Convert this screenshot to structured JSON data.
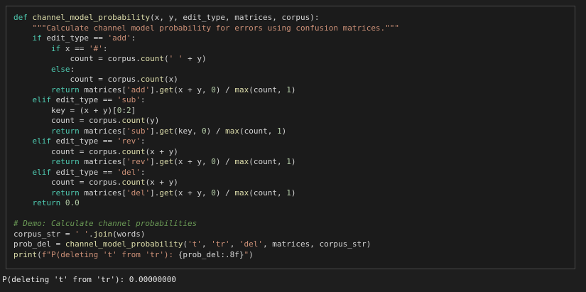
{
  "code_cell": {
    "lines": [
      [
        {
          "t": "def ",
          "c": "keyword"
        },
        {
          "t": "channel_model_probability",
          "c": "fn"
        },
        {
          "t": "(x, y, edit_type, matrices, corpus):",
          "c": "default"
        }
      ],
      [
        {
          "t": "    \"\"\"Calculate channel model probability for errors using confusion matrices.\"\"\"",
          "c": "docstring"
        }
      ],
      [
        {
          "t": "    ",
          "c": "default"
        },
        {
          "t": "if",
          "c": "keyword"
        },
        {
          "t": " edit_type ",
          "c": "default"
        },
        {
          "t": "==",
          "c": "op"
        },
        {
          "t": " ",
          "c": "default"
        },
        {
          "t": "'add'",
          "c": "string"
        },
        {
          "t": ":",
          "c": "default"
        }
      ],
      [
        {
          "t": "        ",
          "c": "default"
        },
        {
          "t": "if",
          "c": "keyword"
        },
        {
          "t": " x ",
          "c": "default"
        },
        {
          "t": "==",
          "c": "op"
        },
        {
          "t": " ",
          "c": "default"
        },
        {
          "t": "'#'",
          "c": "string"
        },
        {
          "t": ":",
          "c": "default"
        }
      ],
      [
        {
          "t": "            count ",
          "c": "default"
        },
        {
          "t": "=",
          "c": "op"
        },
        {
          "t": " corpus.",
          "c": "default"
        },
        {
          "t": "count",
          "c": "fn"
        },
        {
          "t": "(",
          "c": "default"
        },
        {
          "t": "' '",
          "c": "string"
        },
        {
          "t": " + y)",
          "c": "default"
        }
      ],
      [
        {
          "t": "        ",
          "c": "default"
        },
        {
          "t": "else",
          "c": "keyword"
        },
        {
          "t": ":",
          "c": "default"
        }
      ],
      [
        {
          "t": "            count ",
          "c": "default"
        },
        {
          "t": "=",
          "c": "op"
        },
        {
          "t": " corpus.",
          "c": "default"
        },
        {
          "t": "count",
          "c": "fn"
        },
        {
          "t": "(x)",
          "c": "default"
        }
      ],
      [
        {
          "t": "        ",
          "c": "default"
        },
        {
          "t": "return",
          "c": "keyword"
        },
        {
          "t": " matrices[",
          "c": "default"
        },
        {
          "t": "'add'",
          "c": "string"
        },
        {
          "t": "].",
          "c": "default"
        },
        {
          "t": "get",
          "c": "fn"
        },
        {
          "t": "(x + y, ",
          "c": "default"
        },
        {
          "t": "0",
          "c": "number"
        },
        {
          "t": ") / ",
          "c": "default"
        },
        {
          "t": "max",
          "c": "fn"
        },
        {
          "t": "(count, ",
          "c": "default"
        },
        {
          "t": "1",
          "c": "number"
        },
        {
          "t": ")",
          "c": "default"
        }
      ],
      [
        {
          "t": "    ",
          "c": "default"
        },
        {
          "t": "elif",
          "c": "keyword"
        },
        {
          "t": " edit_type ",
          "c": "default"
        },
        {
          "t": "==",
          "c": "op"
        },
        {
          "t": " ",
          "c": "default"
        },
        {
          "t": "'sub'",
          "c": "string"
        },
        {
          "t": ":",
          "c": "default"
        }
      ],
      [
        {
          "t": "        key ",
          "c": "default"
        },
        {
          "t": "=",
          "c": "op"
        },
        {
          "t": " (x + y)[",
          "c": "default"
        },
        {
          "t": "0",
          "c": "number"
        },
        {
          "t": ":",
          "c": "default"
        },
        {
          "t": "2",
          "c": "number"
        },
        {
          "t": "]",
          "c": "default"
        }
      ],
      [
        {
          "t": "        count ",
          "c": "default"
        },
        {
          "t": "=",
          "c": "op"
        },
        {
          "t": " corpus.",
          "c": "default"
        },
        {
          "t": "count",
          "c": "fn"
        },
        {
          "t": "(y)",
          "c": "default"
        }
      ],
      [
        {
          "t": "        ",
          "c": "default"
        },
        {
          "t": "return",
          "c": "keyword"
        },
        {
          "t": " matrices[",
          "c": "default"
        },
        {
          "t": "'sub'",
          "c": "string"
        },
        {
          "t": "].",
          "c": "default"
        },
        {
          "t": "get",
          "c": "fn"
        },
        {
          "t": "(key, ",
          "c": "default"
        },
        {
          "t": "0",
          "c": "number"
        },
        {
          "t": ") / ",
          "c": "default"
        },
        {
          "t": "max",
          "c": "fn"
        },
        {
          "t": "(count, ",
          "c": "default"
        },
        {
          "t": "1",
          "c": "number"
        },
        {
          "t": ")",
          "c": "default"
        }
      ],
      [
        {
          "t": "    ",
          "c": "default"
        },
        {
          "t": "elif",
          "c": "keyword"
        },
        {
          "t": " edit_type ",
          "c": "default"
        },
        {
          "t": "==",
          "c": "op"
        },
        {
          "t": " ",
          "c": "default"
        },
        {
          "t": "'rev'",
          "c": "string"
        },
        {
          "t": ":",
          "c": "default"
        }
      ],
      [
        {
          "t": "        count ",
          "c": "default"
        },
        {
          "t": "=",
          "c": "op"
        },
        {
          "t": " corpus.",
          "c": "default"
        },
        {
          "t": "count",
          "c": "fn"
        },
        {
          "t": "(x + y)",
          "c": "default"
        }
      ],
      [
        {
          "t": "        ",
          "c": "default"
        },
        {
          "t": "return",
          "c": "keyword"
        },
        {
          "t": " matrices[",
          "c": "default"
        },
        {
          "t": "'rev'",
          "c": "string"
        },
        {
          "t": "].",
          "c": "default"
        },
        {
          "t": "get",
          "c": "fn"
        },
        {
          "t": "(x + y, ",
          "c": "default"
        },
        {
          "t": "0",
          "c": "number"
        },
        {
          "t": ") / ",
          "c": "default"
        },
        {
          "t": "max",
          "c": "fn"
        },
        {
          "t": "(count, ",
          "c": "default"
        },
        {
          "t": "1",
          "c": "number"
        },
        {
          "t": ")",
          "c": "default"
        }
      ],
      [
        {
          "t": "    ",
          "c": "default"
        },
        {
          "t": "elif",
          "c": "keyword"
        },
        {
          "t": " edit_type ",
          "c": "default"
        },
        {
          "t": "==",
          "c": "op"
        },
        {
          "t": " ",
          "c": "default"
        },
        {
          "t": "'del'",
          "c": "string"
        },
        {
          "t": ":",
          "c": "default"
        }
      ],
      [
        {
          "t": "        count ",
          "c": "default"
        },
        {
          "t": "=",
          "c": "op"
        },
        {
          "t": " corpus.",
          "c": "default"
        },
        {
          "t": "count",
          "c": "fn"
        },
        {
          "t": "(x + y)",
          "c": "default"
        }
      ],
      [
        {
          "t": "        ",
          "c": "default"
        },
        {
          "t": "return",
          "c": "keyword"
        },
        {
          "t": " matrices[",
          "c": "default"
        },
        {
          "t": "'del'",
          "c": "string"
        },
        {
          "t": "].",
          "c": "default"
        },
        {
          "t": "get",
          "c": "fn"
        },
        {
          "t": "(x + y, ",
          "c": "default"
        },
        {
          "t": "0",
          "c": "number"
        },
        {
          "t": ") / ",
          "c": "default"
        },
        {
          "t": "max",
          "c": "fn"
        },
        {
          "t": "(count, ",
          "c": "default"
        },
        {
          "t": "1",
          "c": "number"
        },
        {
          "t": ")",
          "c": "default"
        }
      ],
      [
        {
          "t": "    ",
          "c": "default"
        },
        {
          "t": "return",
          "c": "keyword"
        },
        {
          "t": " ",
          "c": "default"
        },
        {
          "t": "0.0",
          "c": "number"
        }
      ],
      [
        {
          "t": "",
          "c": "default"
        }
      ],
      [
        {
          "t": "# Demo: Calculate channel probabilities",
          "c": "comment"
        }
      ],
      [
        {
          "t": "corpus_str ",
          "c": "default"
        },
        {
          "t": "=",
          "c": "op"
        },
        {
          "t": " ",
          "c": "default"
        },
        {
          "t": "' '",
          "c": "string"
        },
        {
          "t": ".",
          "c": "default"
        },
        {
          "t": "join",
          "c": "fn"
        },
        {
          "t": "(words)",
          "c": "default"
        }
      ],
      [
        {
          "t": "prob_del ",
          "c": "default"
        },
        {
          "t": "=",
          "c": "op"
        },
        {
          "t": " ",
          "c": "default"
        },
        {
          "t": "channel_model_probability",
          "c": "fn"
        },
        {
          "t": "(",
          "c": "default"
        },
        {
          "t": "'t'",
          "c": "string"
        },
        {
          "t": ", ",
          "c": "default"
        },
        {
          "t": "'tr'",
          "c": "string"
        },
        {
          "t": ", ",
          "c": "default"
        },
        {
          "t": "'del'",
          "c": "string"
        },
        {
          "t": ", matrices, corpus_str)",
          "c": "default"
        }
      ],
      [
        {
          "t": "print",
          "c": "fn"
        },
        {
          "t": "(",
          "c": "default"
        },
        {
          "t": "f\"P(deleting 't' from 'tr'): ",
          "c": "string"
        },
        {
          "t": "{prob_del:.8f}",
          "c": "default"
        },
        {
          "t": "\"",
          "c": "string"
        },
        {
          "t": ")",
          "c": "default"
        }
      ]
    ]
  },
  "output": {
    "text": "P(deleting 't' from 'tr'): 0.00000000"
  },
  "colors": {
    "background": "#1e1e1e",
    "cell_background": "#1b1b1b",
    "cell_border": "#4a4a4a",
    "keyword": "#4ec9b0",
    "function": "#dcdcaa",
    "string": "#ce9178",
    "number": "#b5cea8",
    "comment": "#6a9955"
  }
}
